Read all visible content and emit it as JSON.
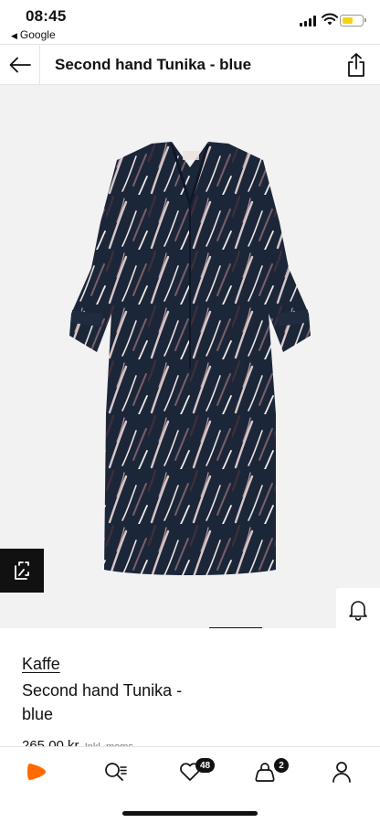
{
  "status_bar": {
    "time": "08:45",
    "back_app": "Google",
    "battery_color": "#f5d40f"
  },
  "header": {
    "title": "Second hand Tunika - blue",
    "back_icon": "arrow-left-icon",
    "share_icon": "share-icon"
  },
  "gallery": {
    "image_alt": "Navy blue printed tunic dress",
    "similar_icon": "find-similar-icon",
    "notify_icon": "bell-icon",
    "page_indicator": {
      "current": 2
    }
  },
  "product": {
    "brand": "Kaffe",
    "name": "Second hand Tunika - blue",
    "price": "265,00 kr",
    "vat_note": "Inkl. moms"
  },
  "bottom_nav": {
    "items": [
      {
        "name": "home",
        "icon": "brand-logo-icon"
      },
      {
        "name": "search",
        "icon": "search-icon"
      },
      {
        "name": "wishlist",
        "icon": "heart-icon",
        "badge": "48"
      },
      {
        "name": "bag",
        "icon": "shopping-bag-icon",
        "badge": "2"
      },
      {
        "name": "account",
        "icon": "user-icon"
      }
    ]
  },
  "colors": {
    "accent": "#ff6900",
    "text": "#111111",
    "gallery_bg": "#f2f2f2"
  }
}
